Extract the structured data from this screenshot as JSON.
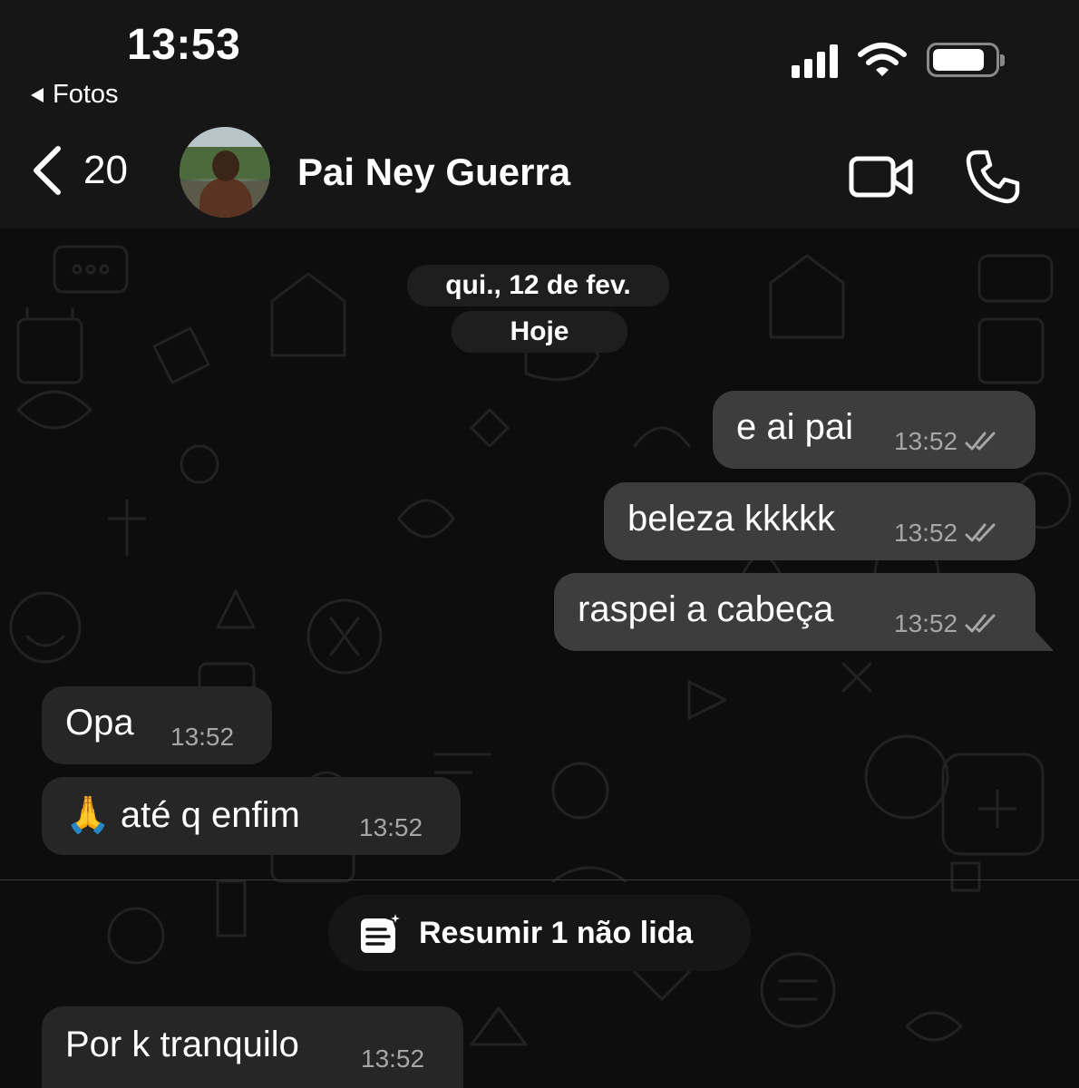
{
  "status_bar": {
    "time": "13:53",
    "back_app_label": "Fotos",
    "battery_level": 0.85
  },
  "header": {
    "unread_count": "20",
    "contact_name": "Pai Ney Guerra",
    "icons": {
      "back": "chevron-left-icon",
      "video": "video-call-icon",
      "phone": "phone-call-icon"
    }
  },
  "chat": {
    "date_separator": "qui., 12 de fev.",
    "today_label": "Hoje",
    "messages": [
      {
        "direction": "outgoing",
        "text": "e ai pai",
        "time": "13:52",
        "status": "read-double-check"
      },
      {
        "direction": "outgoing",
        "text": "beleza kkkkk",
        "time": "13:52",
        "status": "read-double-check"
      },
      {
        "direction": "outgoing",
        "text": "raspei a cabeça",
        "time": "13:52",
        "status": "read-double-check"
      },
      {
        "direction": "incoming",
        "text": "Opa",
        "time": "13:52"
      },
      {
        "direction": "incoming",
        "text": "🙏 até q enfim",
        "time": "13:52"
      },
      {
        "direction": "incoming",
        "text": "Por k tranquilo",
        "time": "13:52"
      }
    ],
    "summarize_button": "Resumir 1 não lida"
  },
  "colors": {
    "header_bg": "#161616",
    "outgoing_bubble": "#3d3d3d",
    "incoming_bubble": "#262626",
    "pill_bg": "#1e1e1e",
    "timestamp": "#a6a6a6"
  }
}
